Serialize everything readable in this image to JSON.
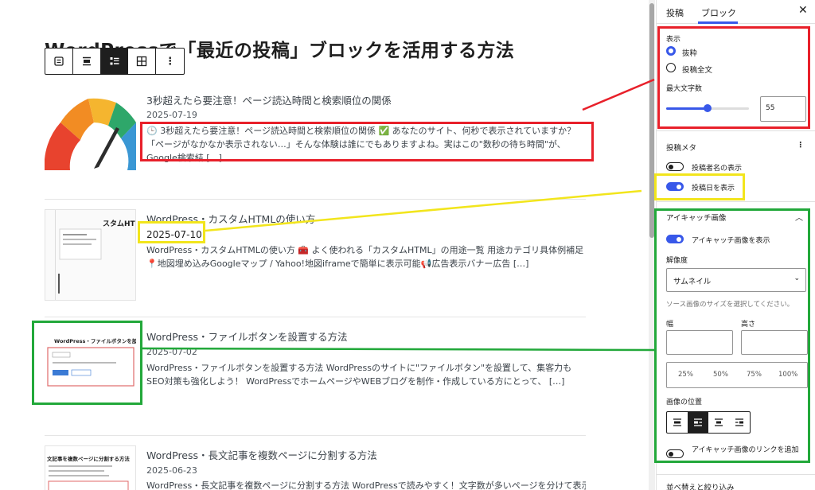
{
  "editor": {
    "post_title": "WordPressで「最近の投稿」ブロックを活用する方法",
    "toolbar": {
      "list_view_icon": "list-view-icon",
      "align_icon": "align-icon",
      "list_layout_icon": "list-layout-icon",
      "grid_layout_icon": "grid-layout-icon",
      "more_label": "⋮"
    },
    "posts": [
      {
        "title": "3秒超えたら要注意！ページ読込時間と検索順位の関係",
        "date": "2025-07-19",
        "excerpt": "🕒 3秒超えたら要注意！ページ読込時間と検索順位の関係 ✅ あなたのサイト、何秒で表示されていますか？ 「ページがなかなか表示されない…」そんな体験は誰にでもありますよね。実はこの\"数秒の待ち時間\"が、Google検索結 […]",
        "thumbnail": "gauge-thumbnail"
      },
      {
        "title": "WordPress・カスタムHTMLの使い方",
        "date": "2025-07-10",
        "excerpt": "WordPress・カスタムHTMLの使い方 🧰 よく使われる「カスタムHTML」の用途一覧 用途カテゴリ具体例補足📍地図埋め込みGoogleマップ / Yahoo!地図iframeで簡単に表示可能📢広告表示バナー広告 […]",
        "thumbnail": "screenshot-thumbnail",
        "thumb_text": "スタムHTM"
      },
      {
        "title": "WordPress・ファイルボタンを設置する方法",
        "date": "2025-07-02",
        "excerpt": "WordPress・ファイルボタンを設置する方法 WordPressのサイトに\"ファイルボタン\"を設置して、集客力もSEO対策も強化しよう！ WordPressでホームページやWEBブログを制作・作成している方にとって、 […]",
        "thumbnail": "screenshot-thumbnail",
        "thumb_text": "WordPress・ファイルボタンを設置"
      },
      {
        "title": "WordPress・長文記事を複数ページに分割する方法",
        "date": "2025-06-23",
        "excerpt": "WordPress・長文記事を複数ページに分割する方法 WordPressで読みやすく！文字数が多いページを分けて表示す",
        "thumbnail": "screenshot-thumbnail",
        "thumb_text": "文記事を複数ページに分割する方法"
      }
    ]
  },
  "sidebar": {
    "tabs": [
      "投稿",
      "ブロック"
    ],
    "active_tab": "ブロック",
    "close_label": "✕",
    "display": {
      "heading": "表示",
      "options": [
        "抜粋",
        "投稿全文"
      ],
      "selected": "抜粋",
      "max_chars_label": "最大文字数",
      "max_chars_value": "55",
      "max_chars_fraction": 0.5
    },
    "post_meta": {
      "heading": "投稿メタ",
      "more_label": "⋮",
      "show_author_label": "投稿者名の表示",
      "show_author": false,
      "show_date_label": "投稿日を表示",
      "show_date": true
    },
    "featured_image": {
      "heading": "アイキャッチ画像",
      "show_label": "アイキャッチ画像を表示",
      "show": true,
      "resolution_label": "解像度",
      "resolution_value": "サムネイル",
      "resolution_help": "ソース画像のサイズを選択してください。",
      "width_label": "幅",
      "height_label": "高さ",
      "percent_options": [
        "25%",
        "50%",
        "75%",
        "100%"
      ],
      "position_label": "画像の位置",
      "link_label": "アイキャッチ画像のリンクを追加",
      "link": false
    },
    "sort_heading": "並べ替えと絞り込み"
  },
  "annotations": {
    "red": "#e8202a",
    "yellow": "#f2e51c",
    "green": "#22a83a"
  },
  "accent_color": "#3858e9"
}
